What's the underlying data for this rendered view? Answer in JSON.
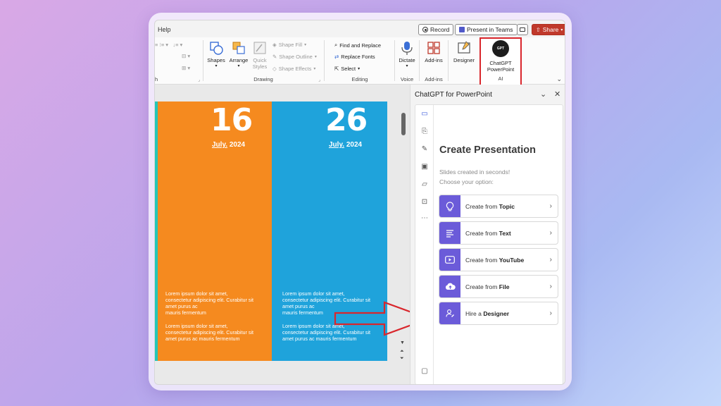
{
  "menu": {
    "help_label": "Help"
  },
  "top_buttons": {
    "record": "Record",
    "teams": "Present in Teams",
    "share": "Share"
  },
  "ribbon": {
    "drawing": {
      "shapes": "Shapes",
      "arrange": "Arrange",
      "quick_styles_1": "Quick",
      "quick_styles_2": "Styles",
      "shape_fill": "Shape Fill",
      "shape_outline": "Shape Outline",
      "shape_effects": "Shape Effects",
      "label": "Drawing"
    },
    "editing": {
      "find_replace": "Find and Replace",
      "replace_fonts": "Replace Fonts",
      "select": "Select",
      "label": "Editing"
    },
    "voice": {
      "dictate": "Dictate",
      "label": "Voice"
    },
    "addins": {
      "addins": "Add-ins",
      "label": "Add-ins"
    },
    "ai": {
      "designer": "Designer",
      "chatgpt_1": "ChatGPT",
      "chatgpt_2": "PowerPoint",
      "logo_text": "GPT",
      "label": "AI"
    },
    "left_group_label": "h"
  },
  "slide": {
    "col1": {
      "day": "16",
      "month": "July.",
      "year": "2024"
    },
    "col2": {
      "day": "26",
      "month": "July.",
      "year": "2024"
    },
    "lorem_1a": "Lorem ipsum dolor sit amet,",
    "lorem_1b": "consectetur adipiscing elit. Curabitur sit",
    "lorem_1c": "amet purus ac",
    "lorem_1d": "mauris fermentum",
    "lorem_2a": "Lorem ipsum dolor sit amet,",
    "lorem_2b": "consectetur adipiscing elit. Curabitur sit",
    "lorem_2c": "amet purus ac mauris fermentum"
  },
  "pane": {
    "title": "ChatGPT for PowerPoint",
    "heading": "Create Presentation",
    "sub1": "Slides created in seconds!",
    "sub2": "Choose your option:",
    "options": [
      {
        "prefix": "Create from ",
        "bold": "Topic",
        "icon": "lightbulb-icon"
      },
      {
        "prefix": "Create from ",
        "bold": "Text",
        "icon": "text-lines-icon"
      },
      {
        "prefix": "Create from ",
        "bold": "YouTube",
        "icon": "play-icon"
      },
      {
        "prefix": "Create from ",
        "bold": "File",
        "icon": "cloud-upload-icon"
      },
      {
        "prefix": "Hire a ",
        "bold": "Designer",
        "icon": "designer-icon"
      }
    ]
  },
  "colors": {
    "orange": "#f58a1f",
    "blue": "#1fa3db",
    "accent": "#6b5bd9",
    "highlight": "#d9262c"
  }
}
